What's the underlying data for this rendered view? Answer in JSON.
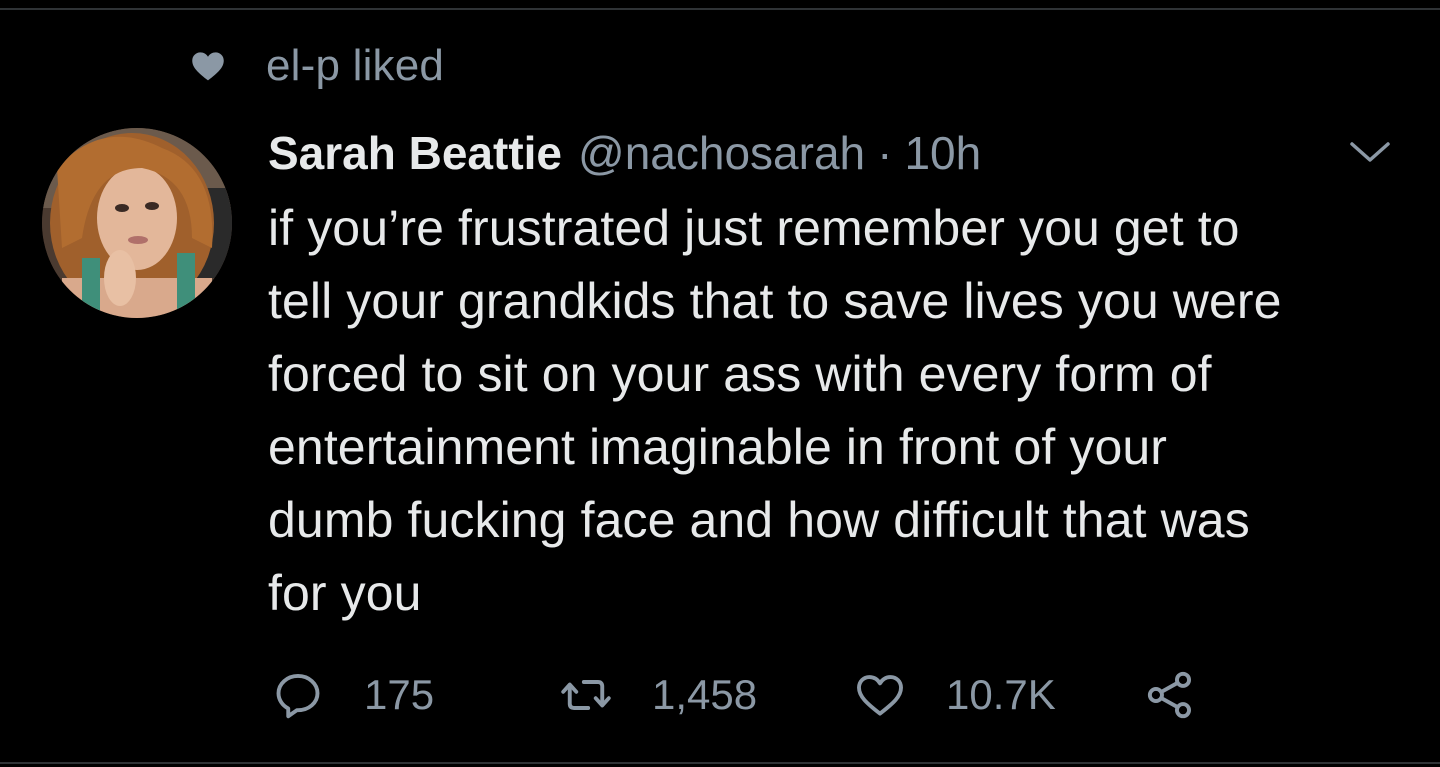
{
  "social_context": {
    "text": "el-p liked",
    "icon": "heart-icon"
  },
  "tweet": {
    "author": {
      "display_name": "Sarah Beattie",
      "handle": "@nachosarah"
    },
    "separator": "·",
    "timestamp": "10h",
    "text": "if you’re frustrated just remember you get to\ntell your grandkids that to save lives you were\nforced to sit on your ass with every form of\nentertainment imaginable in front of your\ndumb fucking face and how difficult that was\nfor you",
    "actions": {
      "reply_count": "175",
      "retweet_count": "1,458",
      "like_count": "10.7K"
    }
  },
  "colors": {
    "background": "#000000",
    "primary_text": "#e7e9ea",
    "secondary_text": "#8b98a5",
    "divider": "#2f3336"
  }
}
